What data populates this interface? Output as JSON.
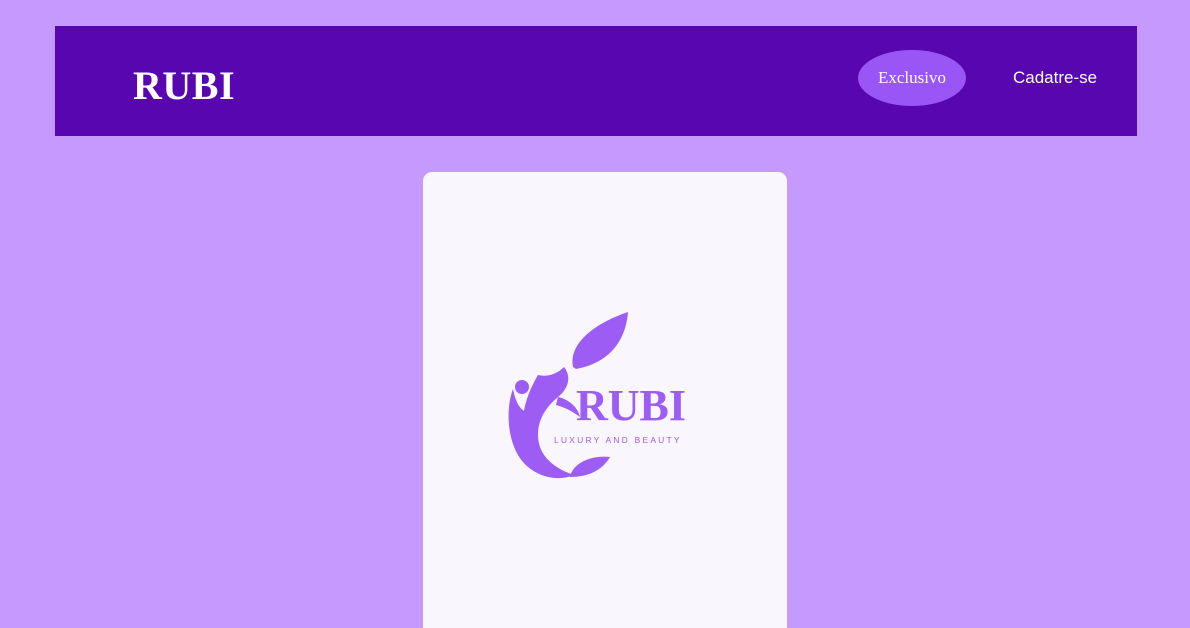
{
  "header": {
    "brand": "RUBI",
    "nav": {
      "exclusive_label": "Exclusivo",
      "signup_label": "Cadatre-se"
    }
  },
  "card": {
    "logo": {
      "wordmark": "RUBI",
      "tagline": "LUXURY AND BEAUTY",
      "icon": "leaf-figure-logo"
    }
  },
  "colors": {
    "page_background": "#c49afe",
    "header_background": "#5807b0",
    "accent": "#9a55f7",
    "card_background": "#f9f6fe",
    "logo": "#9d5cf3"
  }
}
